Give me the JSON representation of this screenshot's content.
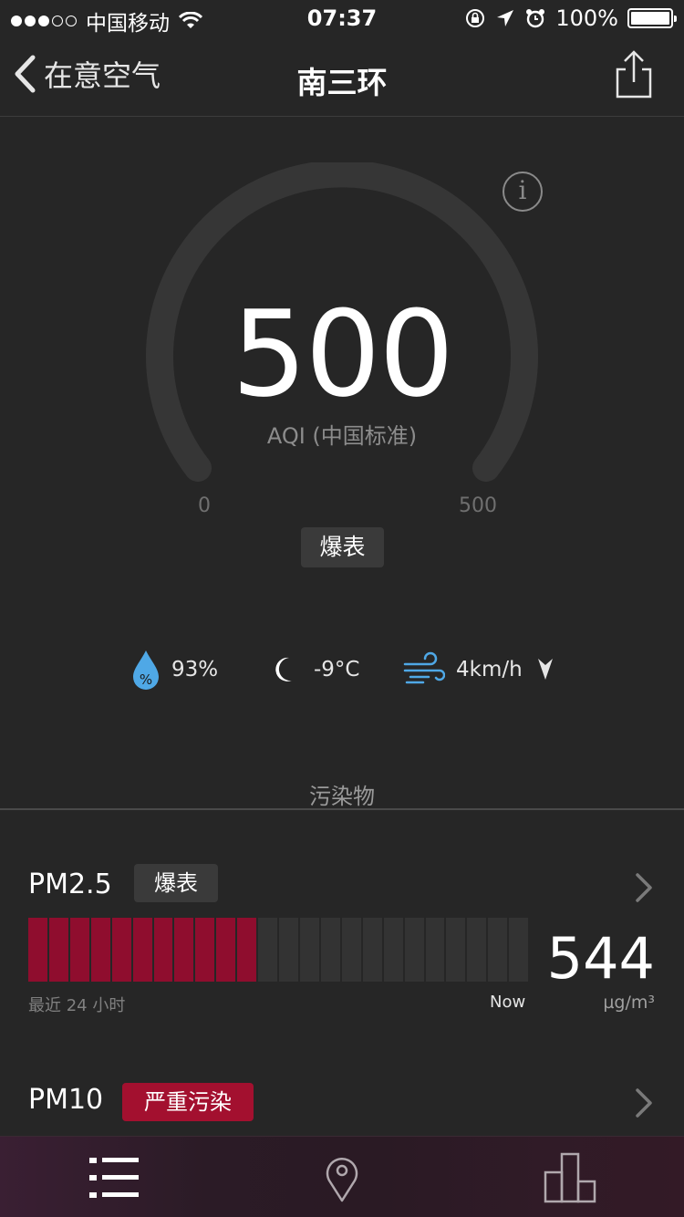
{
  "status_bar": {
    "carrier": "中国移动",
    "time": "07:37",
    "battery": "100%"
  },
  "nav": {
    "back_label": "在意空气",
    "title": "南三环"
  },
  "gauge": {
    "aqi": "500",
    "aqi_label": "AQI (中国标准)",
    "scale_min": "0",
    "scale_max": "500",
    "level": "爆表",
    "level_fraction": 1.0
  },
  "weather": {
    "humidity": "93%",
    "temperature": "-9°C",
    "wind": "4km/h"
  },
  "pollutants": {
    "section_title": "污染物",
    "pm25": {
      "name": "PM2.5",
      "badge": "爆表",
      "history_label": "最近 24 小时",
      "now_label": "Now",
      "value": "544",
      "unit": "µg/m³",
      "bars_total": 24,
      "bars_filled": 11,
      "bar_color": "#8f0d2e"
    },
    "pm10": {
      "name": "PM10",
      "badge": "严重污染",
      "badge_color": "#a3102f"
    }
  },
  "colors": {
    "background": "#262626",
    "accent_red": "#8f0d2e",
    "weather_blue": "#4fa8e6"
  }
}
